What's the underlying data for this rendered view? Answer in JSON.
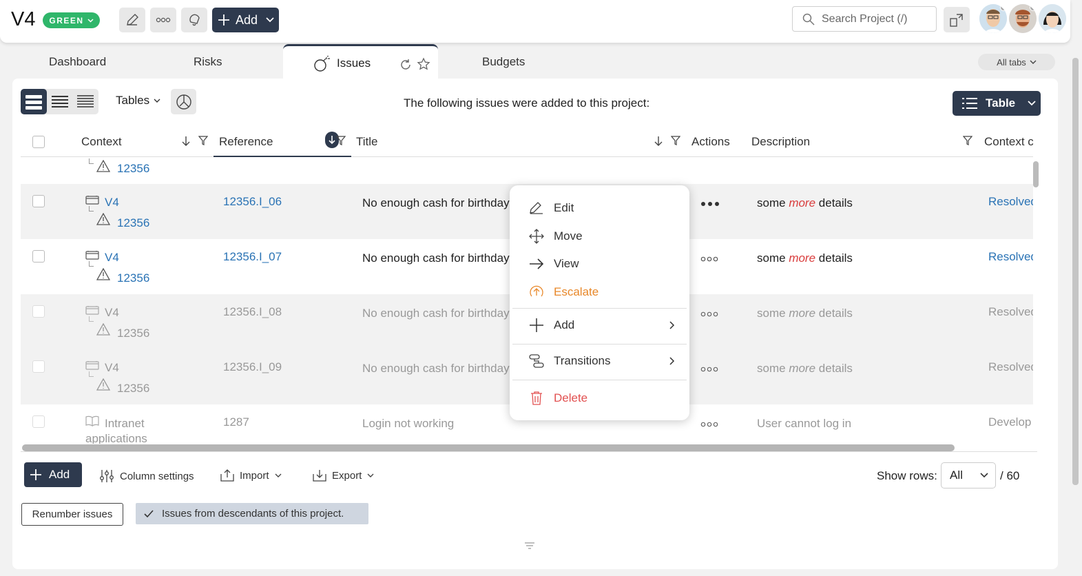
{
  "header": {
    "project": "V4",
    "status": "GREEN",
    "add_label": "Add",
    "search_placeholder": "Search Project (/)"
  },
  "tabs": {
    "items": [
      "Dashboard",
      "Risks",
      "Issues",
      "Budgets"
    ],
    "active": "Issues",
    "all_tabs": "All tabs"
  },
  "toolbar": {
    "tables_label": "Tables",
    "info": "The following issues were added to this project:",
    "view_label": "Table"
  },
  "table": {
    "columns": [
      "Context",
      "Reference",
      "Title",
      "Actions",
      "Description",
      "Context c"
    ],
    "partial_row": {
      "issue": "12356"
    },
    "rows": [
      {
        "context": "V4",
        "issue": "12356",
        "reference": "12356.I_06",
        "title": "No enough cash for birthday",
        "desc_before": "some",
        "desc_em": "more",
        "desc_after": "details",
        "status": "Resolved"
      },
      {
        "context": "V4",
        "issue": "12356",
        "reference": "12356.I_07",
        "title": "No enough cash for birthday",
        "desc_before": "some",
        "desc_em": "more",
        "desc_after": "details",
        "status": "Resolved"
      },
      {
        "context": "V4",
        "issue": "12356",
        "reference": "12356.I_08",
        "title": "No enough cash for birthday",
        "desc_before": "some",
        "desc_em": "more",
        "desc_after": "details",
        "status": "Resolved"
      },
      {
        "context": "V4",
        "issue": "12356",
        "reference": "12356.I_09",
        "title": "No enough cash for birthday",
        "desc_before": "some",
        "desc_em": "more",
        "desc_after": "details",
        "status": "Resolved"
      },
      {
        "context": "Intranet",
        "context2": "applications",
        "reference": "1287",
        "title": "Login not working",
        "description": "User cannot log in",
        "status": "Develop"
      }
    ]
  },
  "context_menu": {
    "edit": "Edit",
    "move": "Move",
    "view": "View",
    "escalate": "Escalate",
    "add": "Add",
    "transitions": "Transitions",
    "delete": "Delete"
  },
  "footer": {
    "add_label": "Add",
    "column_settings": "Column settings",
    "import": "Import",
    "export": "Export",
    "show_rows_label": "Show rows:",
    "show_rows_value": "All",
    "total": "/ 60",
    "renumber": "Renumber issues",
    "descendants": "Issues from descendants of this project."
  },
  "colors": {
    "dark": "#2e3a4e",
    "green": "#2fb66a",
    "link": "#2a73b5",
    "escalate": "#e8882a",
    "delete": "#e25151"
  }
}
